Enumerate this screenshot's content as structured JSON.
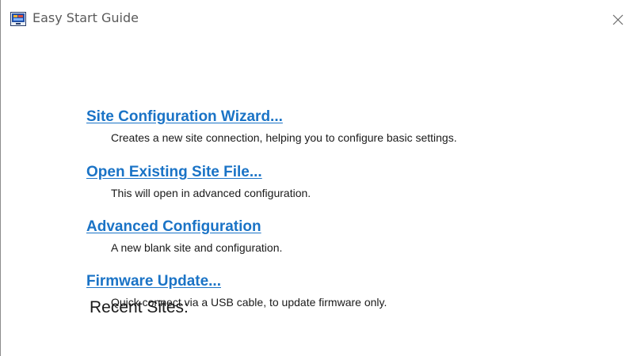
{
  "window": {
    "title": "Easy Start Guide",
    "app_icon": "monitor-app-icon",
    "close_icon": "close-icon"
  },
  "options": [
    {
      "label": "Site Configuration Wizard...",
      "description": "Creates a new site connection, helping you to configure basic settings."
    },
    {
      "label": "Open Existing Site File...",
      "description": "This will open in advanced configuration."
    },
    {
      "label": "Advanced Configuration",
      "description": "A new blank site and configuration."
    },
    {
      "label": "Firmware Update...",
      "description": "Quick connect via a USB cable, to update firmware only."
    }
  ],
  "recent": {
    "heading": "Recent Sites:"
  },
  "colors": {
    "link": "#1a73c6",
    "text": "#1a1a1a",
    "title_text": "#5a5a5a"
  }
}
